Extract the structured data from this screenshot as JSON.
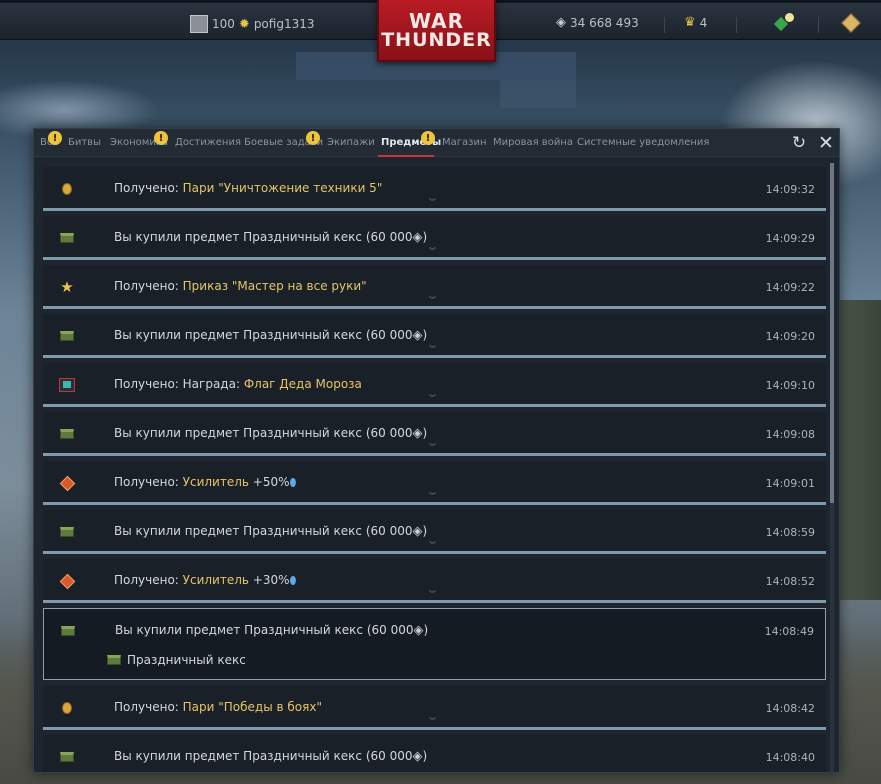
{
  "topbar": {
    "player_level": "100",
    "player_name": "pofig1313",
    "logo_line1": "WAR",
    "logo_line2": "THUNDER",
    "silver_lions": "34 668 493",
    "eagles": "4"
  },
  "tabs": [
    {
      "label": "Все",
      "badge": "!"
    },
    {
      "label": "Битвы",
      "badge": ""
    },
    {
      "label": "Экономика",
      "badge": "!"
    },
    {
      "label": "Достижения",
      "badge": ""
    },
    {
      "label": "Боевые задачи",
      "badge": "!"
    },
    {
      "label": "Экипажи",
      "badge": ""
    },
    {
      "label": "Предметы",
      "badge": "!",
      "active": true
    },
    {
      "label": "Магазин",
      "badge": ""
    },
    {
      "label": "Мировая война",
      "badge": ""
    },
    {
      "label": "Системные уведомления",
      "badge": ""
    }
  ],
  "notifications": [
    {
      "icon": "bet-coin-icon",
      "prefix": "Получено: ",
      "highlight": "Пари \"Уничтожение техники 5\"",
      "suffix": "",
      "time": "14:09:32"
    },
    {
      "icon": "chest-icon",
      "prefix": "Вы купили предмет Праздничный кекс (60 000",
      "highlight": "",
      "suffix": ")",
      "time": "14:09:29"
    },
    {
      "icon": "star-icon",
      "prefix": "Получено: ",
      "highlight": "Приказ \"Мастер на все руки\"",
      "suffix": "",
      "time": "14:09:22"
    },
    {
      "icon": "chest-icon",
      "prefix": "Вы купили предмет Праздничный кекс (60 000",
      "highlight": "",
      "suffix": ")",
      "time": "14:09:20"
    },
    {
      "icon": "flag-icon",
      "prefix": "Получено: Награда: ",
      "highlight": "Флаг Деда Мороза",
      "suffix": "",
      "time": "14:09:10"
    },
    {
      "icon": "chest-icon",
      "prefix": "Вы купили предмет Праздничный кекс (60 000",
      "highlight": "",
      "suffix": ")",
      "time": "14:09:08"
    },
    {
      "icon": "booster-icon",
      "prefix": "Получено: ",
      "highlight": "Усилитель",
      "suffix": " +50%",
      "time": "14:09:01"
    },
    {
      "icon": "chest-icon",
      "prefix": "Вы купили предмет Праздничный кекс (60 000",
      "highlight": "",
      "suffix": ")",
      "time": "14:08:59"
    },
    {
      "icon": "booster-icon",
      "prefix": "Получено: ",
      "highlight": "Усилитель",
      "suffix": " +30%",
      "time": "14:08:52"
    },
    {
      "icon": "chest-icon",
      "prefix": "Вы купили предмет Праздничный кекс (60 000",
      "highlight": "",
      "suffix": ")",
      "time": "14:08:49",
      "expanded": true,
      "detail": "Праздничный кекс"
    },
    {
      "icon": "bet-coin-icon",
      "prefix": "Получено: ",
      "highlight": "Пари \"Победы в боях\"",
      "suffix": "",
      "time": "14:08:42"
    },
    {
      "icon": "chest-icon",
      "prefix": "Вы купили предмет Праздничный кекс (60 000",
      "highlight": "",
      "suffix": ")",
      "time": "14:08:40"
    }
  ]
}
